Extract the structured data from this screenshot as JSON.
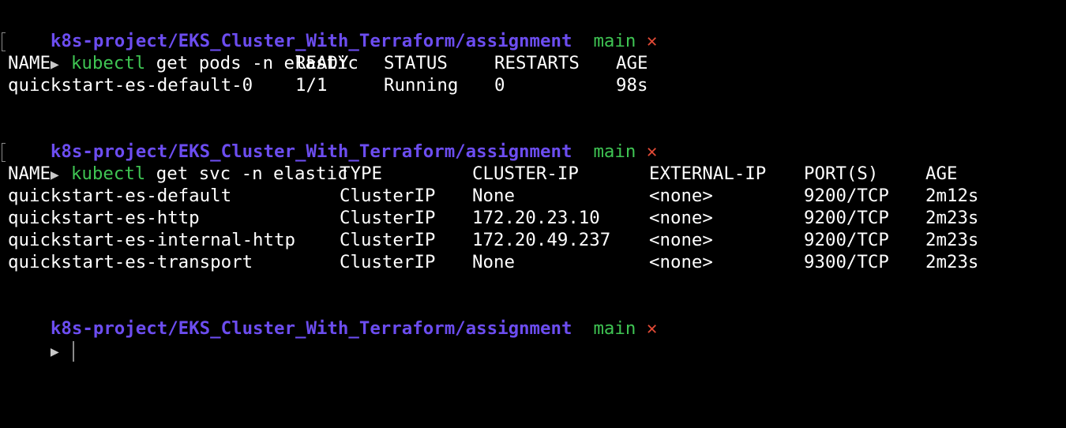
{
  "prompts": [
    {
      "path": "k8s-project/EKS_Cluster_With_Terraform/assignment",
      "branch": "main",
      "dirty": "✕"
    },
    {
      "path": "k8s-project/EKS_Cluster_With_Terraform/assignment",
      "branch": "main",
      "dirty": "✕"
    },
    {
      "path": "k8s-project/EKS_Cluster_With_Terraform/assignment",
      "branch": "main",
      "dirty": "✕"
    }
  ],
  "commands": [
    {
      "arrow": "▶",
      "program": "kubectl",
      "args": " get pods -n elastic"
    },
    {
      "arrow": "▶",
      "program": "kubectl",
      "args": " get svc -n elastic"
    },
    {
      "arrow": "▶"
    }
  ],
  "pods": {
    "headers": [
      "NAME",
      "READY",
      "STATUS",
      "RESTARTS",
      "AGE"
    ],
    "rows": [
      [
        "quickstart-es-default-0",
        "1/1",
        "Running",
        "0",
        "98s"
      ]
    ]
  },
  "svc": {
    "headers": [
      "NAME",
      "TYPE",
      "CLUSTER-IP",
      "EXTERNAL-IP",
      "PORT(S)",
      "AGE"
    ],
    "rows": [
      [
        "quickstart-es-default",
        "ClusterIP",
        "None",
        "<none>",
        "9200/TCP",
        "2m12s"
      ],
      [
        "quickstart-es-http",
        "ClusterIP",
        "172.20.23.10",
        "<none>",
        "9200/TCP",
        "2m23s"
      ],
      [
        "quickstart-es-internal-http",
        "ClusterIP",
        "172.20.49.237",
        "<none>",
        "9200/TCP",
        "2m23s"
      ],
      [
        "quickstart-es-transport",
        "ClusterIP",
        "None",
        "<none>",
        "9300/TCP",
        "2m23s"
      ]
    ]
  },
  "colors": {
    "background": "#000000",
    "path": "#6c4df0",
    "branch": "#3fc553",
    "dirty": "#e24a36",
    "text": "#ffffff"
  }
}
